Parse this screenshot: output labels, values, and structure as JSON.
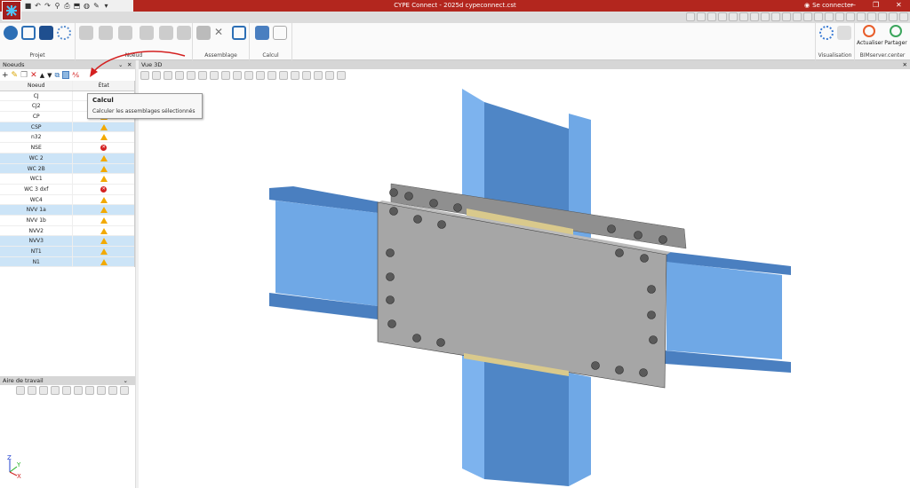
{
  "window": {
    "title": "CYPE Connect - 2025d cypeconnect.cst",
    "connect_label": "Se connecter",
    "minimize": "—",
    "restore": "❐",
    "close": "✕"
  },
  "ribbon": {
    "groups": [
      {
        "label": "Projet"
      },
      {
        "label": "Noeud"
      },
      {
        "label": "Assemblage"
      },
      {
        "label": "Calcul"
      },
      {
        "label": "Visualisation"
      },
      {
        "label": "BIMserver.center"
      }
    ],
    "buttons": {
      "update": "Actualiser",
      "share": "Partager"
    }
  },
  "nodes_panel": {
    "title": "Noeuds",
    "columns": [
      "Noeud",
      "État"
    ],
    "rows": [
      {
        "name": "CJ",
        "status": "warning",
        "selected": false
      },
      {
        "name": "CJ2",
        "status": "warning",
        "selected": false
      },
      {
        "name": "CP",
        "status": "warning",
        "selected": false
      },
      {
        "name": "CSP",
        "status": "warning",
        "selected": true
      },
      {
        "name": "n32",
        "status": "warning",
        "selected": false
      },
      {
        "name": "NSE",
        "status": "error",
        "selected": false
      },
      {
        "name": "WC 2",
        "status": "warning",
        "selected": true
      },
      {
        "name": "WC 2B",
        "status": "warning",
        "selected": true
      },
      {
        "name": "WC1",
        "status": "warning",
        "selected": false
      },
      {
        "name": "WC 3 dxf",
        "status": "error",
        "selected": false
      },
      {
        "name": "WC4",
        "status": "warning",
        "selected": false
      },
      {
        "name": "NVV 1a",
        "status": "warning",
        "selected": true
      },
      {
        "name": "NVV 1b",
        "status": "warning",
        "selected": false
      },
      {
        "name": "NVV2",
        "status": "warning",
        "selected": false
      },
      {
        "name": "NVV3",
        "status": "warning",
        "selected": true
      },
      {
        "name": "NT1",
        "status": "warning",
        "selected": true
      },
      {
        "name": "N1",
        "status": "warning",
        "selected": true
      }
    ]
  },
  "tooltip": {
    "title": "Calcul",
    "text": "Calculer les assemblages sélectionnés"
  },
  "view3d": {
    "title": "Vue 3D"
  },
  "workspace": {
    "title": "Aire de travail"
  },
  "axes": {
    "z": "Z",
    "y": "Y",
    "x": "X"
  },
  "colors": {
    "titlebar": "#b3261e",
    "selection": "#cce4f7",
    "beam": "#6fa8e6",
    "plate": "#a6a6a6",
    "warning": "#f2a900",
    "error": "#d42020",
    "arrow": "#d42020"
  }
}
